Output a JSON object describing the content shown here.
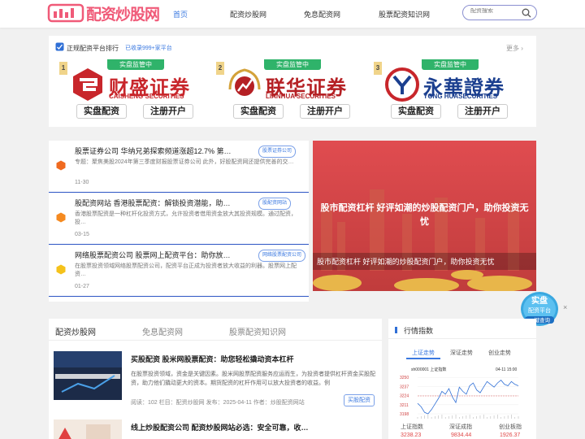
{
  "header": {
    "logo_text": "配资炒股网",
    "nav": [
      "首页",
      "配资炒股网",
      "免息配资网",
      "股票配资知识网"
    ],
    "search_placeholder": "配资搜索"
  },
  "brokers": {
    "title": "正规配资平台排行",
    "subtitle": "已收录999+家平台",
    "more": "更多",
    "badge": "实盘监管中",
    "btn_trade": "实盘配资",
    "btn_register": "注册开户",
    "items": [
      {
        "rank": "1",
        "name": "财盛证券",
        "en": "CAISHENG SECURITIES",
        "color": "#c8262b"
      },
      {
        "rank": "2",
        "name": "联华证券",
        "en": "LIANHUA SECURITIES",
        "color": "#b52024"
      },
      {
        "rank": "3",
        "name": "永華證券",
        "en": "YONG HUASECURITIES",
        "color": "#1b3f8f"
      }
    ]
  },
  "news": [
    {
      "title": "股票证券公司 华纳兄弟探索频道涨超12.7% 第…",
      "tag": "股票证券公司",
      "desc": "专题：聚焦美股2024年第三季度财报股票证券公司 此外，好股配资网还提供完善的交…",
      "date": "11-30",
      "icon_color": "#f06a1f"
    },
    {
      "title": "股配资网站 香港股票配资：解锁投资潜能，助…",
      "tag": "股配资网站",
      "desc": "香港股票配资是一种杠杆化投资方式，允许投资者借用资金放大其投资规模。通过配资，投…",
      "date": "03-15",
      "icon_color": "#f58a20"
    },
    {
      "title": "网络股票配资公司 股票网上配资平台：助你放…",
      "tag": "网络股票配资公司",
      "desc": "在股票投资领域网络股票配资公司，配资平台正成为投资者放大收益的利器。股票网上配资…",
      "date": "01-27",
      "icon_color": "#f5c21b"
    }
  ],
  "banner": {
    "title": "股市配资杠杆 好评如潮的炒股配资门户，助你投资无忧",
    "caption": "股市配资杠杆 好评如潮的炒股配资门户，助你投资无忧"
  },
  "float": {
    "line1": "实盘",
    "line2": "配资平台",
    "line3": "一键查询",
    "close": "×"
  },
  "list": {
    "tabs": [
      "配资炒股网",
      "免息配资网",
      "股票配资知识网"
    ],
    "articles": [
      {
        "title": "买股配资 股米网股票配资：助您轻松撬动资本杠杆",
        "desc": "在股票投资领域，资金是关键因素。股米网股票配资服务应运而生，为投资者提供杠杆资金买股配资，助力他们撬动更大的资本。期货配资的杠杆作用可以放大投资者的收益。例",
        "meta": "阅读：102   栏目：配资炒股网   发布：2025-04-11   作者：炒股配资网站",
        "tag": "买股配资"
      },
      {
        "title": "线上炒股配资公司 配资炒股网站必选：安全可靠，收…"
      }
    ]
  },
  "market": {
    "title": "行情指数",
    "tabs": [
      "上证走势",
      "深证走势",
      "创业走势"
    ],
    "chart_header_left": "sh000001   上证指数",
    "chart_header_right": "04-11 15:00",
    "y_ticks": [
      "3250",
      "3237",
      "3224",
      "3211",
      "3198"
    ],
    "labels": [
      "上证指数",
      "深证成指",
      "创业板指"
    ],
    "values": [
      "3238.23",
      "9834.44",
      "1926.37"
    ]
  },
  "chart_data": {
    "type": "line",
    "title": "",
    "ylim": [
      3198,
      3256
    ],
    "series": [
      {
        "values": [
          3213,
          3208,
          3200,
          3198,
          3204,
          3212,
          3220,
          3230,
          3226,
          3234,
          3222,
          3214,
          3236,
          3230,
          3226,
          3238,
          3242,
          3232,
          3228,
          3236,
          3244,
          3240,
          3236,
          3242,
          3246,
          3240,
          3238,
          3244,
          3240,
          3238
        ]
      }
    ]
  }
}
